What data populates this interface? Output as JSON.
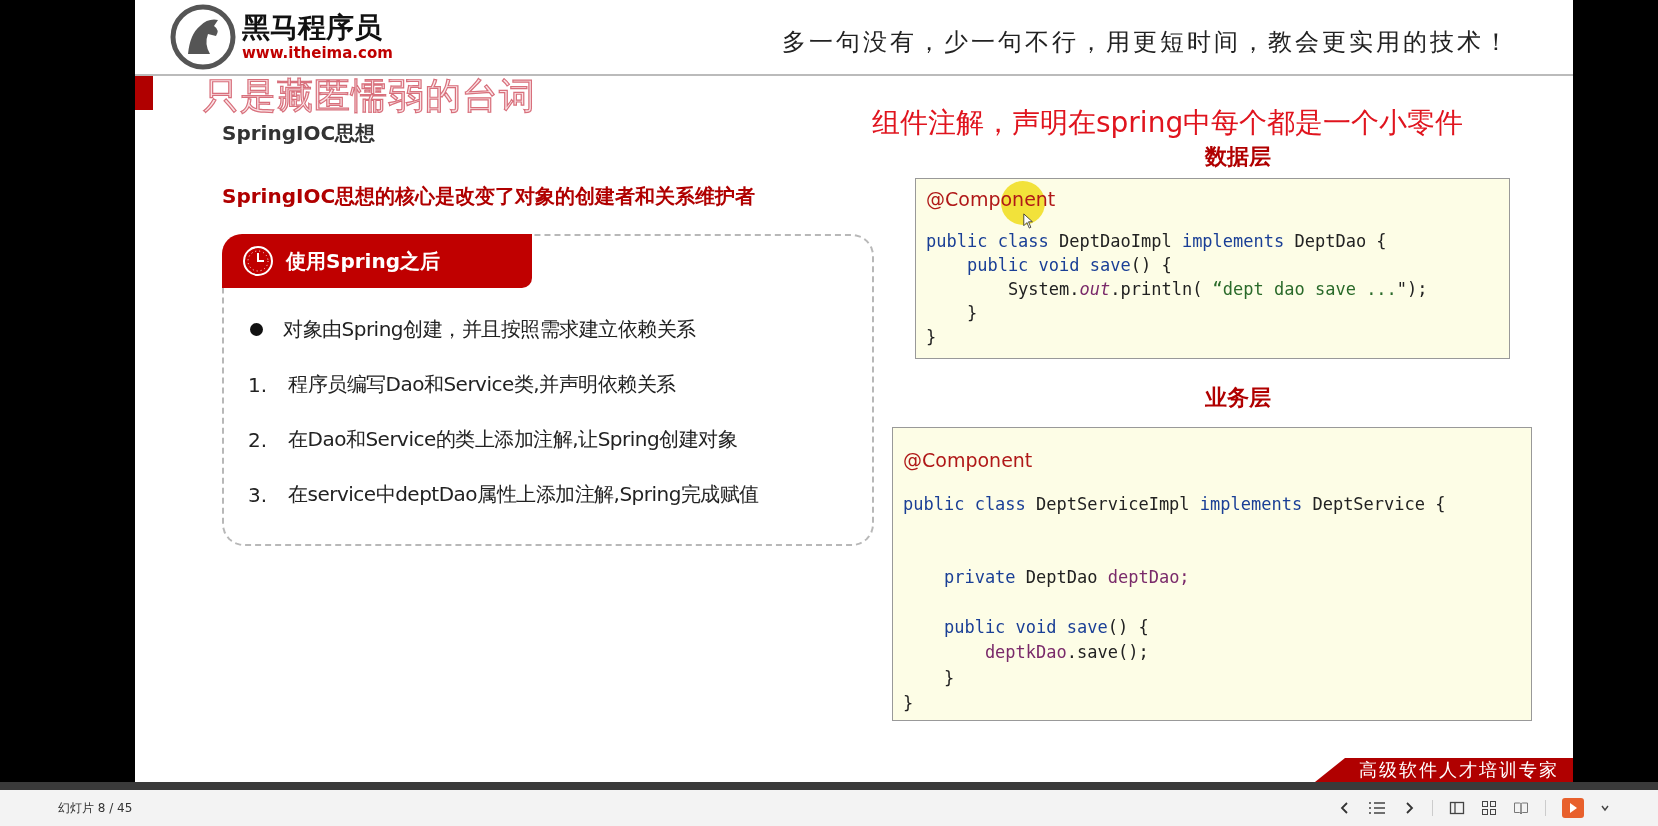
{
  "header": {
    "logo_name": "黑马程序员",
    "logo_url": "www.itheima.com",
    "slogan": "多一句没有，少一句不行，用更短时间，教会更实用的技术！"
  },
  "subtitle_overlay": "只是藏匿懦弱的台词",
  "slide": {
    "section_title": "SpringIOC思想",
    "heading": "SpringIOC思想的核心是改变了对象的创建者和关系维护者",
    "annotation": "组件注解，声明在spring中每个都是一个小零件",
    "card": {
      "title": "使用Spring之后",
      "items": [
        {
          "kind": "bullet",
          "text": "对象由Spring创建，并且按照需求建立依赖关系"
        },
        {
          "kind": "numbered",
          "marker": "1.",
          "text": "程序员编写Dao和Service类,并声明依赖关系"
        },
        {
          "kind": "numbered",
          "marker": "2.",
          "text": "在Dao和Service的类上添加注解,让Spring创建对象"
        },
        {
          "kind": "numbered",
          "marker": "3.",
          "text": "在service中deptDao属性上添加注解,Spring完成赋值"
        }
      ]
    },
    "code_blocks": [
      {
        "label": "数据层",
        "cursor": true,
        "lines": [
          {
            "kind": "annotation",
            "tokens": [
              {
                "t": "@Component",
                "kind": "annotation"
              }
            ]
          },
          {
            "kind": "code",
            "tokens": [
              {
                "t": "public class ",
                "kind": "keyword"
              },
              {
                "t": "DeptDaoImpl ",
                "kind": "plain"
              },
              {
                "t": "implements ",
                "kind": "keyword"
              },
              {
                "t": "DeptDao {",
                "kind": "plain"
              }
            ]
          },
          {
            "kind": "code",
            "tokens": [
              {
                "t": "    public void save",
                "kind": "keyword"
              },
              {
                "t": "() {",
                "kind": "plain"
              }
            ]
          },
          {
            "kind": "code",
            "tokens": [
              {
                "t": "        System.",
                "kind": "plain"
              },
              {
                "t": "out",
                "kind": "static"
              },
              {
                "t": ".println( ",
                "kind": "plain"
              },
              {
                "t": "“dept dao save ...",
                "kind": "string"
              },
              {
                "t": "\");",
                "kind": "plain"
              }
            ]
          },
          {
            "kind": "code",
            "tokens": [
              {
                "t": "    }",
                "kind": "plain"
              }
            ]
          },
          {
            "kind": "code",
            "tokens": [
              {
                "t": "}",
                "kind": "plain"
              }
            ]
          }
        ]
      },
      {
        "label": "业务层",
        "cursor": false,
        "lines": [
          {
            "kind": "annotation",
            "tokens": [
              {
                "t": "@Component",
                "kind": "annotation"
              }
            ]
          },
          {
            "kind": "code",
            "tokens": [
              {
                "t": "public class ",
                "kind": "keyword"
              },
              {
                "t": "DeptServiceImpl ",
                "kind": "plain"
              },
              {
                "t": "implements ",
                "kind": "keyword"
              },
              {
                "t": "DeptService {",
                "kind": "plain"
              }
            ]
          },
          {
            "kind": "blank"
          },
          {
            "kind": "blank"
          },
          {
            "kind": "code",
            "tokens": [
              {
                "t": "    private ",
                "kind": "keyword"
              },
              {
                "t": "DeptDao ",
                "kind": "plain"
              },
              {
                "t": "deptDao;",
                "kind": "field"
              }
            ]
          },
          {
            "kind": "blank"
          },
          {
            "kind": "code",
            "tokens": [
              {
                "t": "    public void save",
                "kind": "keyword"
              },
              {
                "t": "() {",
                "kind": "plain"
              }
            ]
          },
          {
            "kind": "code",
            "tokens": [
              {
                "t": "        deptkDao",
                "kind": "field"
              },
              {
                "t": ".save();",
                "kind": "plain"
              }
            ]
          },
          {
            "kind": "code",
            "tokens": [
              {
                "t": "    }",
                "kind": "plain"
              }
            ]
          },
          {
            "kind": "code",
            "tokens": [
              {
                "t": "}",
                "kind": "plain"
              }
            ]
          }
        ]
      }
    ]
  },
  "footer_banner": "高级软件人才培训专家",
  "status_bar": {
    "slide_counter": "幻灯片 8 / 45"
  }
}
